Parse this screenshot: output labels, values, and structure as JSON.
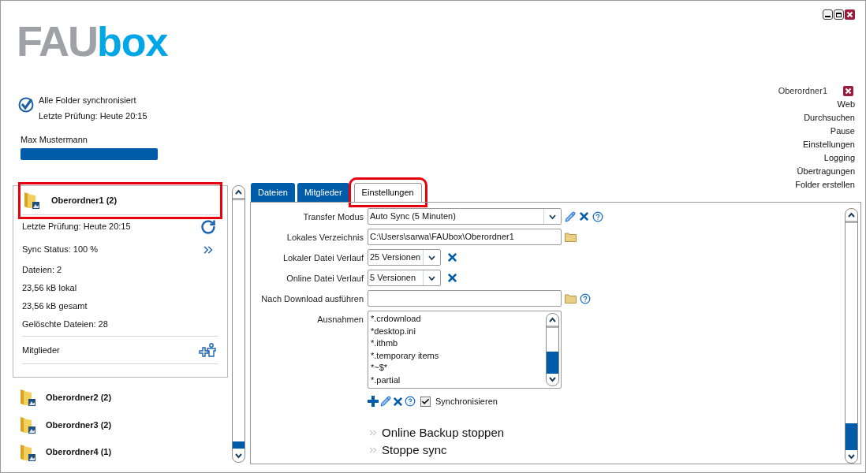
{
  "logo": {
    "gray": "FAU",
    "blue": "box"
  },
  "status": {
    "checked": true,
    "lines": [
      "Alle Folder synchronisiert",
      "Letzte Prüfung: Heute 20:15"
    ]
  },
  "user": {
    "name": "Max Mustermann",
    "level": 1
  },
  "folder_menu": {
    "title": "Oberordner1",
    "items": [
      "Web",
      "Durchsuchen",
      "Pause",
      "Einstellungen",
      "Logging",
      "Übertragungen",
      "Folder erstellen"
    ]
  },
  "folders": [
    {
      "name": "Oberordner1 (2)",
      "expanded": true,
      "highlighted": true,
      "details": [
        {
          "text": "Letzte Prüfung: Heute 20:15",
          "kind": "refresh"
        },
        {
          "text": "Sync Status: 100 %",
          "kind": "forward"
        },
        {
          "text": "Dateien: 2",
          "kind": "plain"
        },
        {
          "text": "23,56 kB lokal",
          "kind": "plain"
        },
        {
          "text": "23,56 kB gesamt",
          "kind": "plain"
        },
        {
          "text": "Gelöschte Dateien: 28",
          "kind": "plain"
        }
      ],
      "members": "Mitglieder"
    },
    {
      "name": "Oberordner2 (2)",
      "expanded": false,
      "highlighted": false
    },
    {
      "name": "Oberordner3 (2)",
      "expanded": false,
      "highlighted": false
    },
    {
      "name": "Oberordner4 (1)",
      "expanded": false,
      "highlighted": false
    }
  ],
  "tabs": [
    {
      "label": "Dateien",
      "selected": false,
      "highlighted": false
    },
    {
      "label": "Mitglieder",
      "selected": false,
      "highlighted": false
    },
    {
      "label": "Einstellungen",
      "selected": true,
      "highlighted": true
    }
  ],
  "settings": {
    "transfer_mode": {
      "label": "Transfer Modus",
      "value": "Auto Sync (5 Minuten)"
    },
    "local_directory": {
      "label": "Lokales Verzeichnis",
      "value": "C:\\Users\\sarwa\\FAUbox\\Oberordner1"
    },
    "local_history": {
      "label": "Lokaler Datei Verlauf",
      "value": "25 Versionen"
    },
    "online_history": {
      "label": "Online Datei Verlauf",
      "value": "5 Versionen"
    },
    "post_download": {
      "label": "Nach Download ausführen"
    },
    "exclusions": {
      "label": "Ausnahmen",
      "items": [
        "*.crdownload",
        "*desktop.ini",
        "*.ithmb",
        "*.temporary items",
        "*~$*",
        "*.partial"
      ]
    },
    "sync_checkbox": {
      "label": "Synchronisieren",
      "checked": true
    },
    "actions": [
      "Online Backup stoppen",
      "Stoppe sync"
    ]
  }
}
